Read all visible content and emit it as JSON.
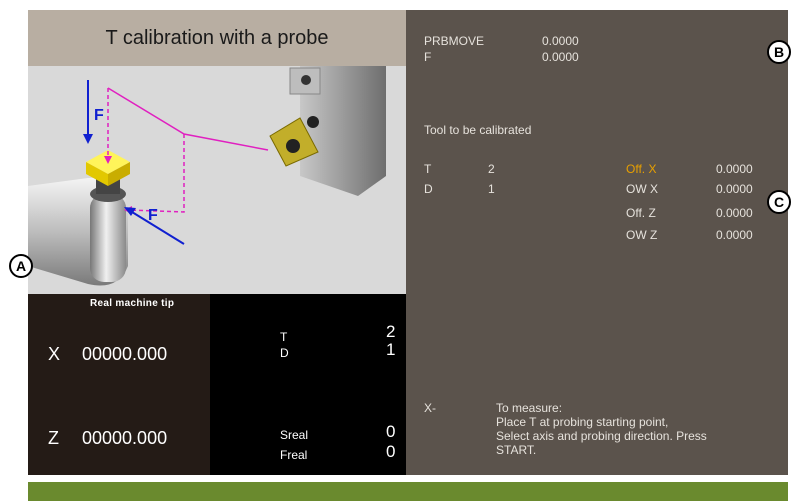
{
  "title": "T calibration with a probe",
  "tip": {
    "heading": "Real machine tip",
    "x_label": "X",
    "x_value": "00000.000",
    "z_label": "Z",
    "z_value": "00000.000"
  },
  "td": {
    "t_label": "T",
    "t_value": "2",
    "d_label": "D",
    "d_value": "1",
    "sreal_label": "Sreal",
    "sreal_value": "0",
    "freal_label": "Freal",
    "freal_value": "0"
  },
  "params": {
    "prbmove_label": "PRBMOVE",
    "prbmove_value": "0.0000",
    "f_label": "F",
    "f_value": "0.0000"
  },
  "tool_heading": "Tool to be calibrated",
  "tool": {
    "t_label": "T",
    "t_value": "2",
    "d_label": "D",
    "d_value": "1"
  },
  "offsets": [
    {
      "label": "Off. X",
      "value": "0.0000",
      "highlight": true
    },
    {
      "label": "OW X",
      "value": "0.0000",
      "highlight": false
    },
    {
      "label": "Off. Z",
      "value": "0.0000",
      "highlight": false
    },
    {
      "label": "OW Z",
      "value": "0.0000",
      "highlight": false
    }
  ],
  "message": {
    "axis": "X-",
    "line1": "To measure:",
    "line2": "Place T at probing starting point,",
    "line3": "Select axis and probing direction. Press",
    "line4": "START."
  },
  "markers": {
    "a": "A",
    "b": "B",
    "c": "C"
  },
  "illustration": {
    "f_top": "F",
    "f_bottom": "F"
  },
  "colors": {
    "title_bg": "#b8aea2",
    "right_bg": "#5b534c",
    "highlight": "#e8a000",
    "bottom_bar": "#6a8a2e",
    "path_magenta": "#e020c0",
    "arrow_blue": "#1020d0",
    "probe_yellow": "#f2e000"
  }
}
